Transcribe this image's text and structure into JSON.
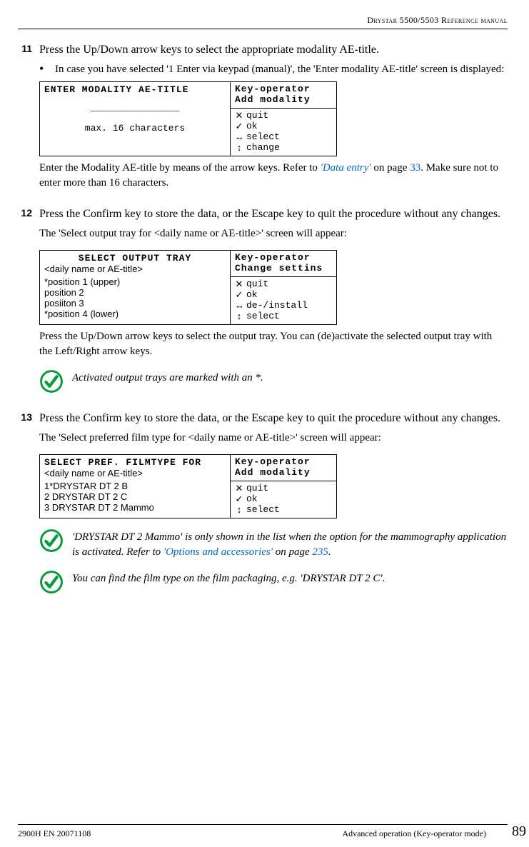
{
  "header": "Drystar 5500/5503 Reference manual",
  "steps": {
    "s11": {
      "num": "11",
      "title": "Press the Up/Down arrow keys to select the appropriate modality AE-title.",
      "bullet": "In case you have selected '1 Enter via keypad (manual)', the 'Enter modality AE-title' screen is displayed:",
      "lcd": {
        "title": "ENTER MODALITY AE-TITLE",
        "line_dashes": "________________",
        "line_max": "max. 16 characters",
        "right_top1": "Key-operator",
        "right_top2": "Add modality",
        "opt_quit": "quit",
        "opt_ok": "ok",
        "opt_select": "select",
        "opt_change": "change"
      },
      "after1a": "Enter the Modality AE-title by means of the arrow keys. Refer to ",
      "after1b": "'Data entry'",
      "after1c": " on page ",
      "after1d": "33",
      "after1e": ". Make sure not to enter more than 16 characters."
    },
    "s12": {
      "num": "12",
      "title": "Press the Confirm key to store the data, or the Escape key to quit the procedure without any changes.",
      "sub1": "The 'Select output tray for <daily name or AE-title>' screen will appear:",
      "lcd": {
        "title": "SELECT OUTPUT TRAY",
        "sub": "<daily name or AE-title>",
        "l1": "*position 1 (upper)",
        "l2": "  position 2",
        "l3": "  posiiton 3",
        "l4": "*position 4 (lower)",
        "right_top1": "Key-operator",
        "right_top2": "Change settins",
        "opt_quit": "quit",
        "opt_ok": "ok",
        "opt_de": "de-/install",
        "opt_select": "select"
      },
      "after": "Press the Up/Down arrow keys to select the output tray. You can (de)activate the selected output tray with the Left/Right arrow keys.",
      "note": "Activated output trays are marked with an *."
    },
    "s13": {
      "num": "13",
      "title": "Press the Confirm key to store the data, or the Escape key to quit the procedure without any changes.",
      "sub1": "The 'Select preferred film type for <daily name or AE-title>' screen will appear:",
      "lcd": {
        "title": "SELECT PREF. FILMTYPE FOR",
        "sub": "<daily name or AE-title>",
        "l1": "1*DRYSTAR DT 2 B",
        "l2": "2 DRYSTAR DT 2 C",
        "l3": "3 DRYSTAR DT 2 Mammo",
        "right_top1": "Key-operator",
        "right_top2": "Add modality",
        "opt_quit": "quit",
        "opt_ok": "ok",
        "opt_select": "select"
      },
      "note1a": " 'DRYSTAR DT 2 Mammo' is only shown in the list when the option for the mammography application is activated. Refer to ",
      "note1b": "'Options and accessories'",
      "note1c": " on page ",
      "note1d": "235",
      "note1e": ".",
      "note2": "You can find the film type on the film packaging, e.g. 'DRYSTAR DT 2 C'."
    }
  },
  "footer": {
    "left": "2900H EN 20071108",
    "right": "Advanced operation (Key-operator mode)",
    "page": "89"
  }
}
